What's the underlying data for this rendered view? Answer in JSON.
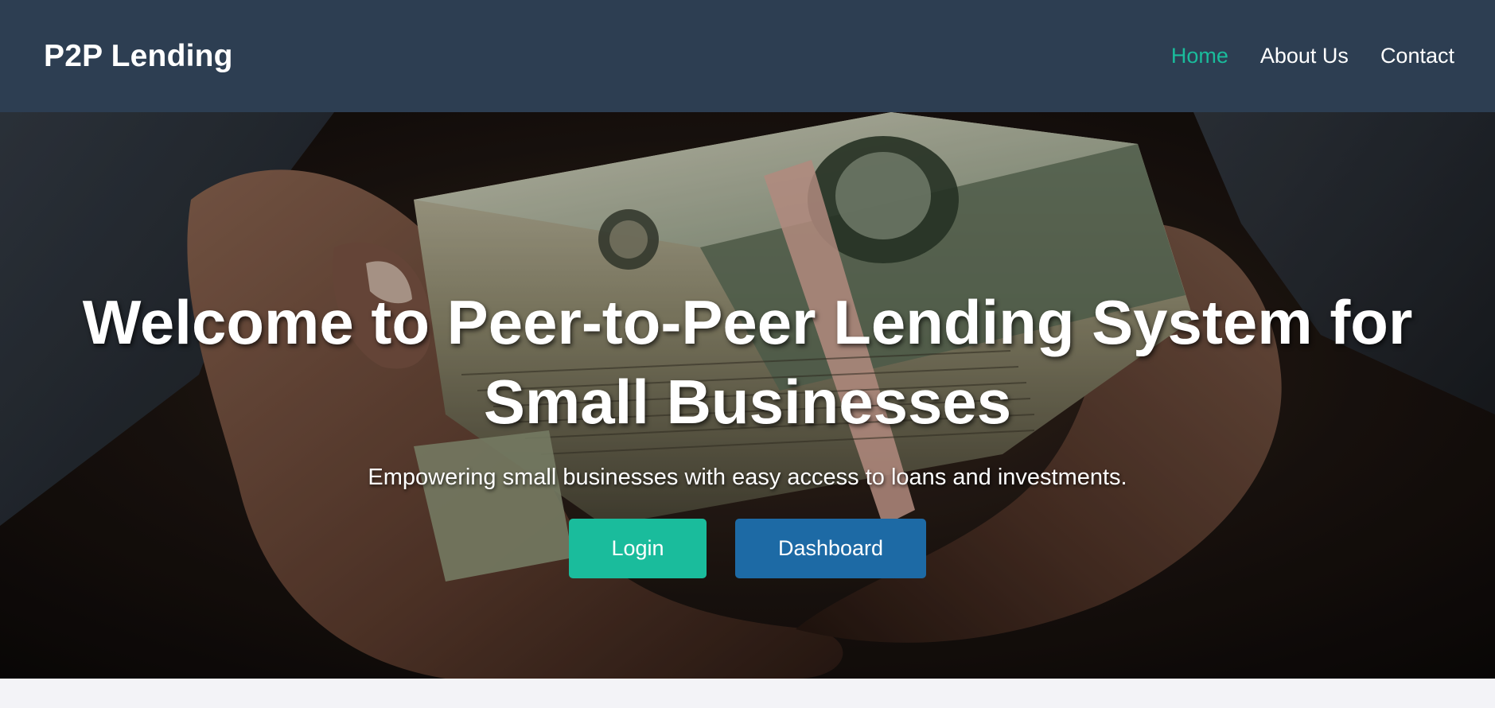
{
  "header": {
    "brand": "P2P Lending",
    "nav": [
      {
        "label": "Home",
        "active": true
      },
      {
        "label": "About Us",
        "active": false
      },
      {
        "label": "Contact",
        "active": false
      }
    ]
  },
  "hero": {
    "title": "Welcome to Peer-to-Peer Lending System for Small Businesses",
    "subtitle": "Empowering small businesses with easy access to loans and investments.",
    "background_image": "hands holding stack of 100-dollar bills",
    "buttons": {
      "login_label": "Login",
      "dashboard_label": "Dashboard"
    }
  },
  "colors": {
    "header_bg": "#2d3e52",
    "accent": "#1abc9c",
    "dashboard_button": "#1d6aa5",
    "page_bg": "#f3f3f7"
  }
}
